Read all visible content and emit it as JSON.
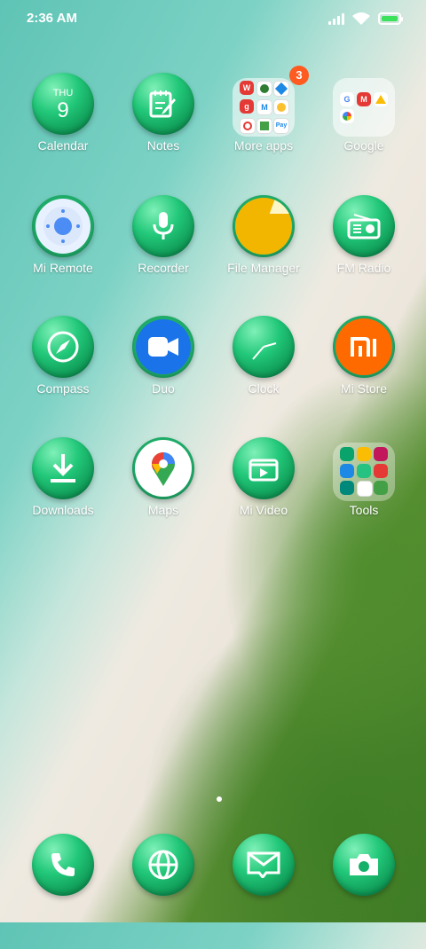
{
  "status": {
    "time": "2:36 AM"
  },
  "apps": {
    "calendar": {
      "label": "Calendar",
      "day": "THU",
      "date": "9"
    },
    "notes": {
      "label": "Notes"
    },
    "more_apps": {
      "label": "More apps",
      "badge": "3"
    },
    "google": {
      "label": "Google"
    },
    "mi_remote": {
      "label": "Mi Remote"
    },
    "recorder": {
      "label": "Recorder"
    },
    "file_manager": {
      "label": "File Manager"
    },
    "fm_radio": {
      "label": "FM Radio"
    },
    "compass": {
      "label": "Compass"
    },
    "duo": {
      "label": "Duo"
    },
    "clock": {
      "label": "Clock"
    },
    "mi_store": {
      "label": "Mi Store",
      "logo": "mi"
    },
    "downloads": {
      "label": "Downloads"
    },
    "maps": {
      "label": "Maps"
    },
    "mi_video": {
      "label": "Mi Video"
    },
    "tools": {
      "label": "Tools"
    }
  },
  "folder_more_apps": {
    "letters": [
      "W",
      "",
      "",
      "g",
      "M",
      "",
      "",
      "",
      "Pay"
    ]
  },
  "colors": {
    "icon_green": "#15b069",
    "badge": "#ff5a1f",
    "file_manager_yellow": "#f3b600",
    "mi_store_orange": "#ff6a00",
    "duo_blue": "#1a73e8"
  },
  "dock": [
    "phone-icon",
    "browser-icon",
    "messaging-icon",
    "camera-icon"
  ]
}
